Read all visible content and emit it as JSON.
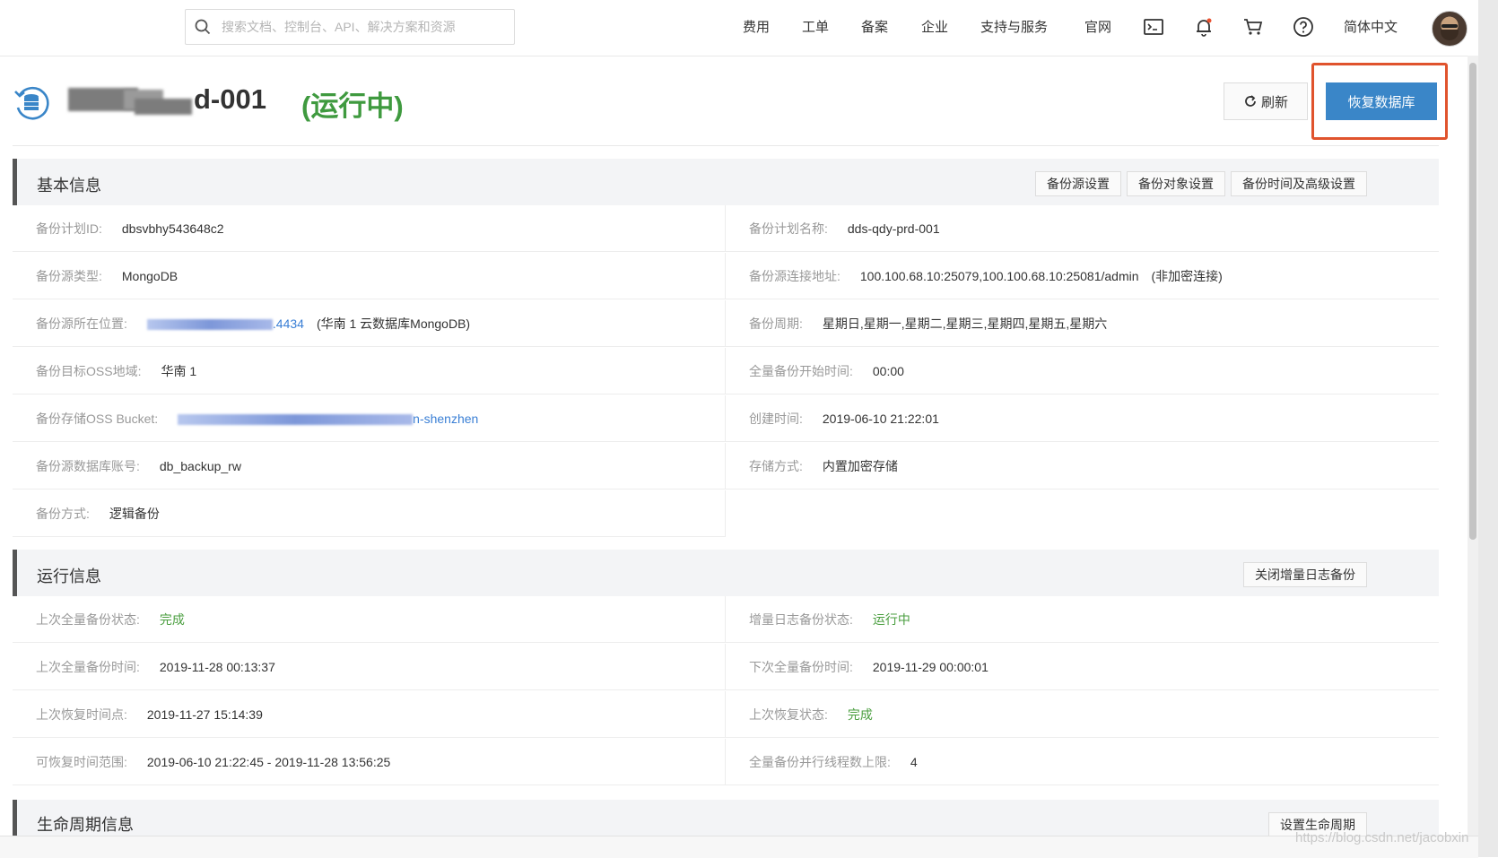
{
  "search": {
    "placeholder": "搜索文档、控制台、API、解决方案和资源"
  },
  "nav": {
    "items": [
      "费用",
      "工单",
      "备案",
      "企业",
      "支持与服务",
      "官网"
    ],
    "language": "简体中文"
  },
  "header": {
    "title_suffix": "d-001",
    "status": "(运行中)",
    "refresh_label": "刷新",
    "restore_label": "恢复数据库"
  },
  "basic": {
    "title": "基本信息",
    "actions": [
      "备份源设置",
      "备份对象设置",
      "备份时间及高级设置"
    ],
    "plan_id_label": "备份计划ID:",
    "plan_id": "dbsvbhy543648c2",
    "plan_name_label": "备份计划名称:",
    "plan_name": "dds-qdy-prd-001",
    "source_type_label": "备份源类型:",
    "source_type": "MongoDB",
    "conn_label": "备份源连接地址:",
    "conn": "100.100.68.10:25079,100.100.68.10:25081/admin",
    "conn_note": "(非加密连接)",
    "location_label": "备份源所在位置:",
    "location_link": ".4434",
    "location_note": "(华南 1 云数据库MongoDB)",
    "cycle_label": "备份周期:",
    "cycle": "星期日,星期一,星期二,星期三,星期四,星期五,星期六",
    "oss_region_label": "备份目标OSS地域:",
    "oss_region": "华南 1",
    "full_start_label": "全量备份开始时间:",
    "full_start": "00:00",
    "bucket_label": "备份存储OSS Bucket:",
    "bucket_link": "n-shenzhen",
    "created_label": "创建时间:",
    "created": "2019-06-10 21:22:01",
    "account_label": "备份源数据库账号:",
    "account": "db_backup_rw",
    "storage_label": "存储方式:",
    "storage": "内置加密存储",
    "method_label": "备份方式:",
    "method": "逻辑备份"
  },
  "runtime": {
    "title": "运行信息",
    "action": "关闭增量日志备份",
    "last_full_status_label": "上次全量备份状态:",
    "last_full_status": "完成",
    "incr_status_label": "增量日志备份状态:",
    "incr_status": "运行中",
    "last_full_time_label": "上次全量备份时间:",
    "last_full_time": "2019-11-28 00:13:37",
    "next_full_time_label": "下次全量备份时间:",
    "next_full_time": "2019-11-29 00:00:01",
    "last_restore_point_label": "上次恢复时间点:",
    "last_restore_point": "2019-11-27 15:14:39",
    "last_restore_status_label": "上次恢复状态:",
    "last_restore_status": "完成",
    "restore_range_label": "可恢复时间范围:",
    "restore_range": "2019-06-10 21:22:45 - 2019-11-28 13:56:25",
    "threads_label": "全量备份并行线程数上限:",
    "threads": "4"
  },
  "lifecycle": {
    "title": "生命周期信息",
    "action": "设置生命周期"
  },
  "watermark": "https://blog.csdn.net/jacobxin"
}
